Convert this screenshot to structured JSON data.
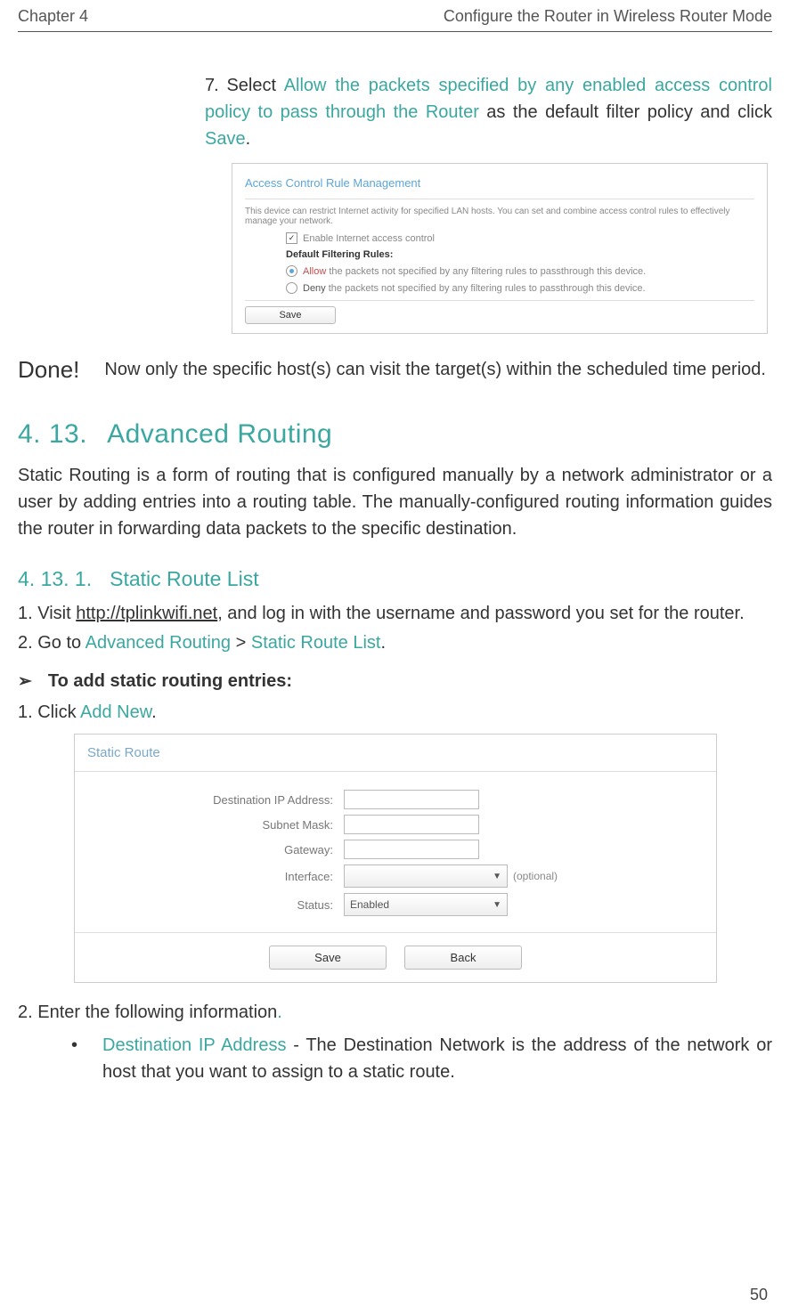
{
  "header": {
    "left": "Chapter 4",
    "right": "Configure the Router in Wireless Router Mode"
  },
  "step7": {
    "num": "7.",
    "t1": "Select ",
    "hl": "Allow the packets specified by any enabled access control policy to pass through the Router",
    "t2": " as the default filter policy and click ",
    "save": "Save",
    "t3": "."
  },
  "fig1": {
    "title": "Access Control Rule Management",
    "desc": "This device can restrict Internet activity for specified LAN hosts. You can set and combine access control rules to effectively manage your network.",
    "enable": "Enable Internet access control",
    "rules": "Default Filtering Rules:",
    "allow": "Allow",
    "allow_txt": " the packets not specified by any filtering rules to passthrough this device.",
    "deny": "Deny",
    "deny_txt": " the packets not specified by any filtering rules to passthrough this device.",
    "save": "Save"
  },
  "done": {
    "label": "Done!",
    "text": "Now only the specific host(s) can visit the target(s) within the scheduled time period."
  },
  "h_main": {
    "num": "4. 13.",
    "title": "Advanced Routing"
  },
  "para1": "Static Routing is a form of routing that is configured manually by a network administrator or a user by adding entries into a routing table. The manually-configured routing information guides the router in forwarding data packets to the specific destination.",
  "h_sub": {
    "num": "4. 13. 1.",
    "title": "Static Route List"
  },
  "li1": {
    "pre": "1. Visit ",
    "link": "http://tplinkwifi.net",
    "post": ", and log in with the username and password you set for the router."
  },
  "li2": {
    "pre": "2. Go to ",
    "a": "Advanced Routing",
    "mid": " > ",
    "b": "Static Route List",
    "post": "."
  },
  "arrow_h": "To add static routing entries:",
  "li3": {
    "pre": "1.  Click ",
    "a": "Add New",
    "post": "."
  },
  "fig2": {
    "title": "Static Route",
    "labels": {
      "dest": "Destination IP Address:",
      "mask": "Subnet Mask:",
      "gw": "Gateway:",
      "iface": "Interface:",
      "status": "Status:"
    },
    "optional": "(optional)",
    "status_value": "Enabled",
    "save": "Save",
    "back": "Back"
  },
  "li4": {
    "pre": "2. Enter the following information",
    "dot": "."
  },
  "bullet": {
    "term": "Destination IP Address",
    "dash": " - ",
    "text": "The Destination Network is the address of the network or host that you want to assign to a static route."
  },
  "page_num": "50"
}
